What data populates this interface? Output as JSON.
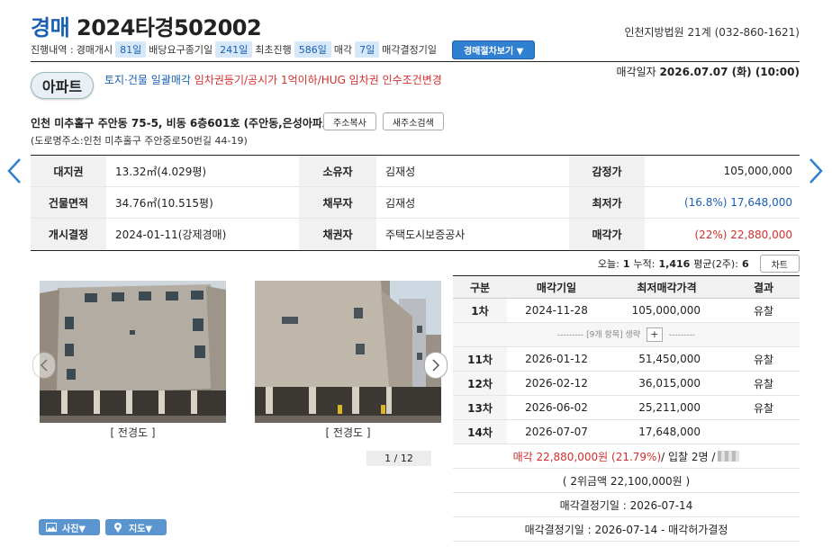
{
  "header": {
    "title_kw": "경매",
    "title_case": "2024타경502002",
    "court": "인천지방법원 21계 (032-860-1621)",
    "sale_date_label": "매각일자",
    "sale_date_value": "2026.07.07 (화) (10:00)"
  },
  "progress": {
    "label": "진행내역 :",
    "steps": [
      {
        "name": "경매개시",
        "days": "81일"
      },
      {
        "name": "배당요구종기일",
        "days": "241일"
      },
      {
        "name": "최초진행",
        "days": "586일"
      },
      {
        "name": "매각",
        "days": "7일"
      },
      {
        "name": "매각결정기일",
        "days": ""
      }
    ],
    "steps_button": "경매절차보기 ▼"
  },
  "property": {
    "type_badge": "아파트",
    "notice_blue": "토지·건물 일괄매각",
    "notice_red": "임차권등기/공시가 1억이하/HUG 임차권 인수조건변경",
    "address": "인천 미추홀구 주안동 75-5, 비동 6층601호 (주안동,은성아파트)",
    "copy_address_button": "주소복사",
    "new_address_button": "새주소검색",
    "road_address": "(도로명주소:인천 미추홀구 주안중로50번길 44-19)"
  },
  "info": {
    "rows": [
      [
        {
          "h": "대지권",
          "v": "13.32㎡(4.029평)"
        },
        {
          "h": "소유자",
          "v": "김재성"
        },
        {
          "h": "감정가",
          "v": "105,000,000"
        }
      ],
      [
        {
          "h": "건물면적",
          "v": "34.76㎡(10.515평)"
        },
        {
          "h": "채무자",
          "v": "김재성"
        },
        {
          "h": "최저가",
          "v": "(16.8%) 17,648,000"
        }
      ],
      [
        {
          "h": "개시결정",
          "v": "2024-01-11(강제경매)"
        },
        {
          "h": "채권자",
          "v": "주택도시보증공사"
        },
        {
          "h": "매각가",
          "v": "(22%) 22,880,000"
        }
      ]
    ]
  },
  "stats": {
    "today_label": "오늘:",
    "today": "1",
    "total_label": "누적:",
    "total": "1,416",
    "avg_label": "평균(2주):",
    "avg": "6",
    "chart_button": "차트"
  },
  "photos": {
    "captions": [
      "[ 전경도 ]",
      "[ 전경도 ]"
    ],
    "pager": "1 / 12",
    "photo_button": "사진▼",
    "map_button": "지도▼"
  },
  "history": {
    "headers": [
      "구분",
      "매각기일",
      "최저매각가격",
      "결과"
    ],
    "rows": [
      {
        "round": "1차",
        "date": "2024-11-28",
        "price": "105,000,000",
        "result": "유찰"
      },
      {
        "round": "11차",
        "date": "2026-01-12",
        "price": "51,450,000",
        "result": "유찰"
      },
      {
        "round": "12차",
        "date": "2026-02-12",
        "price": "36,015,000",
        "result": "유찰"
      },
      {
        "round": "13차",
        "date": "2026-06-02",
        "price": "25,211,000",
        "result": "유찰"
      },
      {
        "round": "14차",
        "date": "2026-07-07",
        "price": "17,648,000",
        "result": ""
      }
    ],
    "omitted_left": "---------",
    "omitted_text": "[9개 항목] 생략",
    "omitted_plus": "+",
    "omitted_right": "---------",
    "sale_result_red": "매각 22,880,000원 (21.79%)",
    "sale_result_rest": " / 입찰 2명 /",
    "second_bid": "( 2위금액 22,100,000원 )",
    "decision_date": "매각결정기일 : 2026-07-14",
    "decision_result": "매각결정기일 : 2026-07-14 - 매각허가결정"
  },
  "colors": {
    "accent": "#1a5fb4",
    "red": "#d32f2f",
    "button_blue": "#2f80d1"
  }
}
